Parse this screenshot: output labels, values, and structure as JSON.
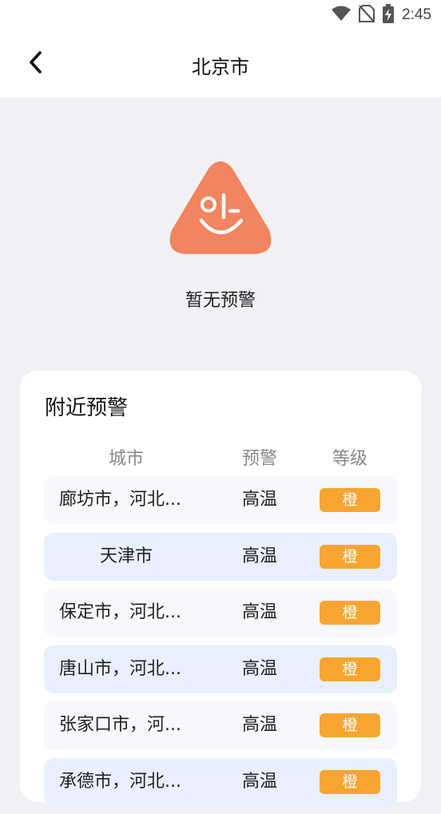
{
  "status_bar": {
    "time": "2:45"
  },
  "header": {
    "title": "北京市"
  },
  "empty_state": {
    "message": "暂无预警"
  },
  "nearby": {
    "title": "附近预警",
    "columns": [
      "城市",
      "预警",
      "等级"
    ],
    "rows": [
      {
        "city": "廊坊市，河北...",
        "type": "高温",
        "level": "橙"
      },
      {
        "city": "天津市",
        "type": "高温",
        "level": "橙"
      },
      {
        "city": "保定市，河北...",
        "type": "高温",
        "level": "橙"
      },
      {
        "city": "唐山市，河北...",
        "type": "高温",
        "level": "橙"
      },
      {
        "city": "张家口市，河...",
        "type": "高温",
        "level": "橙"
      },
      {
        "city": "承德市，河北...",
        "type": "高温",
        "level": "橙"
      }
    ]
  },
  "colors": {
    "accent_orange": "#f7a531",
    "illustration": "#f2845f",
    "row_alt": "#e8f0fd",
    "row": "#f6f8fb"
  },
  "icons": [
    "wifi-icon",
    "no-sim-icon",
    "battery-charging-icon",
    "back-arrow-icon"
  ]
}
